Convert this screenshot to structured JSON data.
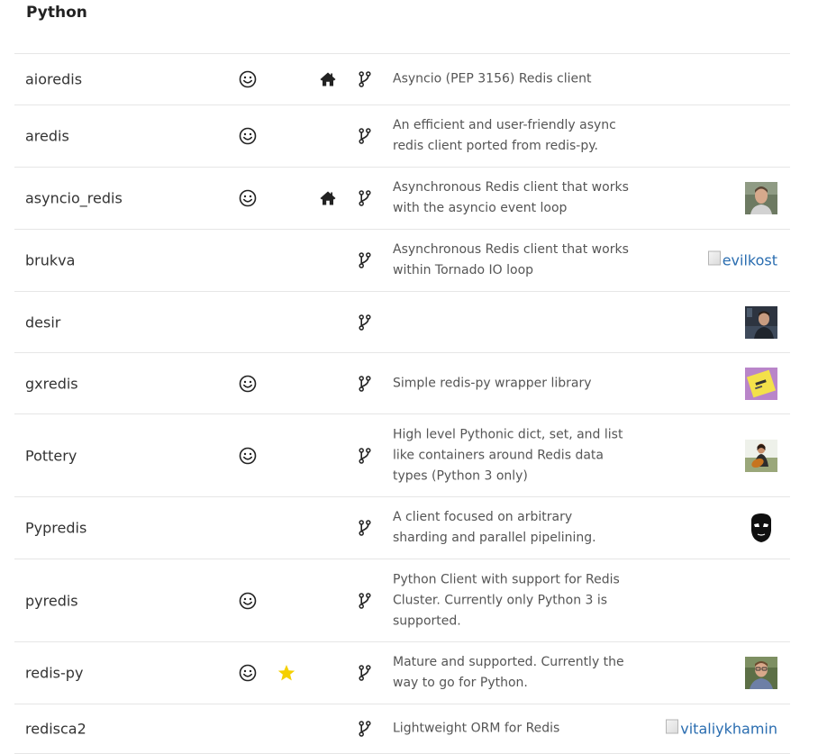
{
  "section": {
    "title": "Python"
  },
  "icons": {
    "active": "smiley-icon",
    "recommended": "star-icon",
    "homepage": "home-icon",
    "repository": "code-fork-icon"
  },
  "colors": {
    "link": "#2a6db0",
    "star": "#f5d000",
    "divider": "#e6e6e6",
    "text": "#333333",
    "description": "#555555"
  },
  "rows": [
    {
      "name": "aioredis",
      "active": true,
      "recommended": false,
      "homepage": true,
      "repository": true,
      "description": "Asyncio (PEP 3156) Redis client",
      "author": null
    },
    {
      "name": "aredis",
      "active": true,
      "recommended": false,
      "homepage": false,
      "repository": true,
      "description": "An efficient and user-friendly async redis client ported from redis-py.",
      "author": null
    },
    {
      "name": "asyncio_redis",
      "active": true,
      "recommended": false,
      "homepage": true,
      "repository": true,
      "description": "Asynchronous Redis client that works with the asyncio event loop",
      "author": {
        "type": "avatar",
        "variant": "a"
      }
    },
    {
      "name": "brukva",
      "active": false,
      "recommended": false,
      "homepage": false,
      "repository": true,
      "description": "Asynchronous Redis client that works within Tornado IO loop",
      "author": {
        "type": "broken",
        "alt": "evilkost"
      }
    },
    {
      "name": "desir",
      "active": false,
      "recommended": false,
      "homepage": false,
      "repository": true,
      "description": "",
      "author": {
        "type": "avatar",
        "variant": "b"
      }
    },
    {
      "name": "gxredis",
      "active": true,
      "recommended": false,
      "homepage": false,
      "repository": true,
      "description": "Simple redis-py wrapper library",
      "author": {
        "type": "avatar",
        "variant": "c"
      }
    },
    {
      "name": "Pottery",
      "active": true,
      "recommended": false,
      "homepage": false,
      "repository": true,
      "description": "High level Pythonic dict, set, and list like containers around Redis data types (Python 3 only)",
      "author": {
        "type": "avatar",
        "variant": "d"
      }
    },
    {
      "name": "Pypredis",
      "active": false,
      "recommended": false,
      "homepage": false,
      "repository": true,
      "description": "A client focused on arbitrary sharding and parallel pipelining.",
      "author": {
        "type": "avatar",
        "variant": "e"
      }
    },
    {
      "name": "pyredis",
      "active": true,
      "recommended": false,
      "homepage": false,
      "repository": true,
      "description": "Python Client with support for Redis Cluster. Currently only Python 3 is supported.",
      "author": null
    },
    {
      "name": "redis-py",
      "active": true,
      "recommended": true,
      "homepage": false,
      "repository": true,
      "description": "Mature and supported. Currently the way to go for Python.",
      "author": {
        "type": "avatar",
        "variant": "f"
      }
    },
    {
      "name": "redisca2",
      "active": false,
      "recommended": false,
      "homepage": false,
      "repository": true,
      "description": "Lightweight ORM for Redis",
      "author": {
        "type": "broken",
        "alt": "vitaliykhamin"
      }
    }
  ]
}
